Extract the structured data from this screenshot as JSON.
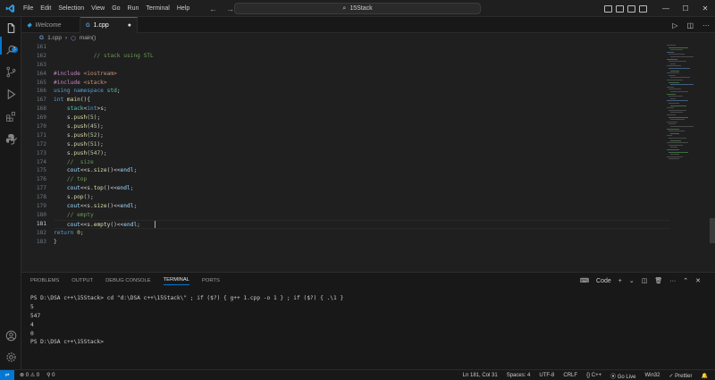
{
  "menu": [
    "File",
    "Edit",
    "Selection",
    "View",
    "Go",
    "Run",
    "Terminal",
    "Help"
  ],
  "search": {
    "text": "15Stack"
  },
  "tabs": [
    {
      "label": "Welcome"
    },
    {
      "label": "1.cpp"
    }
  ],
  "breadcrumb": {
    "file": "1.cpp",
    "symbol": "main()"
  },
  "activity_badge": "1",
  "editor": {
    "lines": [
      {
        "n": "161",
        "text": ""
      },
      {
        "n": "162",
        "text": "            // stack using STL"
      },
      {
        "n": "163",
        "text": ""
      },
      {
        "n": "164",
        "text": "#include <iostream>"
      },
      {
        "n": "165",
        "text": "#include <stack>"
      },
      {
        "n": "166",
        "text": "using namespace std;"
      },
      {
        "n": "167",
        "text": "int main(){"
      },
      {
        "n": "168",
        "text": "    stack<int>s;"
      },
      {
        "n": "169",
        "text": "    s.push(5);"
      },
      {
        "n": "170",
        "text": "    s.push(45);"
      },
      {
        "n": "171",
        "text": "    s.push(52);"
      },
      {
        "n": "172",
        "text": "    s.push(51);"
      },
      {
        "n": "173",
        "text": "    s.push(547);"
      },
      {
        "n": "174",
        "text": "    //  size"
      },
      {
        "n": "175",
        "text": "    cout<<s.size()<<endl;"
      },
      {
        "n": "176",
        "text": "    // top"
      },
      {
        "n": "177",
        "text": "    cout<<s.top()<<endl;"
      },
      {
        "n": "178",
        "text": "    s.pop();"
      },
      {
        "n": "179",
        "text": "    cout<<s.size()<<endl;"
      },
      {
        "n": "180",
        "text": "    // empty"
      },
      {
        "n": "181",
        "text": "    cout<<s.empty()<<endl;"
      },
      {
        "n": "182",
        "text": "return 0;"
      },
      {
        "n": "183",
        "text": "}"
      }
    ]
  },
  "panel": {
    "tabs": [
      "PROBLEMS",
      "OUTPUT",
      "DEBUG CONSOLE",
      "TERMINAL",
      "PORTS"
    ],
    "active_tab": "TERMINAL",
    "shell_label": "Code",
    "terminal": [
      "PS D:\\DSA c++\\15Stack> cd \"d:\\DSA c++\\15Stack\\\" ; if ($?) { g++ 1.cpp -o 1 } ; if ($?) { .\\1 }",
      "5",
      "547",
      "4",
      "0",
      "PS D:\\DSA c++\\15Stack>"
    ]
  },
  "status": {
    "errors": "0",
    "warnings": "0",
    "ports": "0",
    "position": "Ln 181, Col 31",
    "spaces": "Spaces: 4",
    "encoding": "UTF-8",
    "eol": "CRLF",
    "language": "C++",
    "golive": "Go Live",
    "platform": "Win32",
    "prettier": "Prettier"
  },
  "colors": {
    "accent": "#0078d4",
    "background": "#1f1f1f"
  }
}
